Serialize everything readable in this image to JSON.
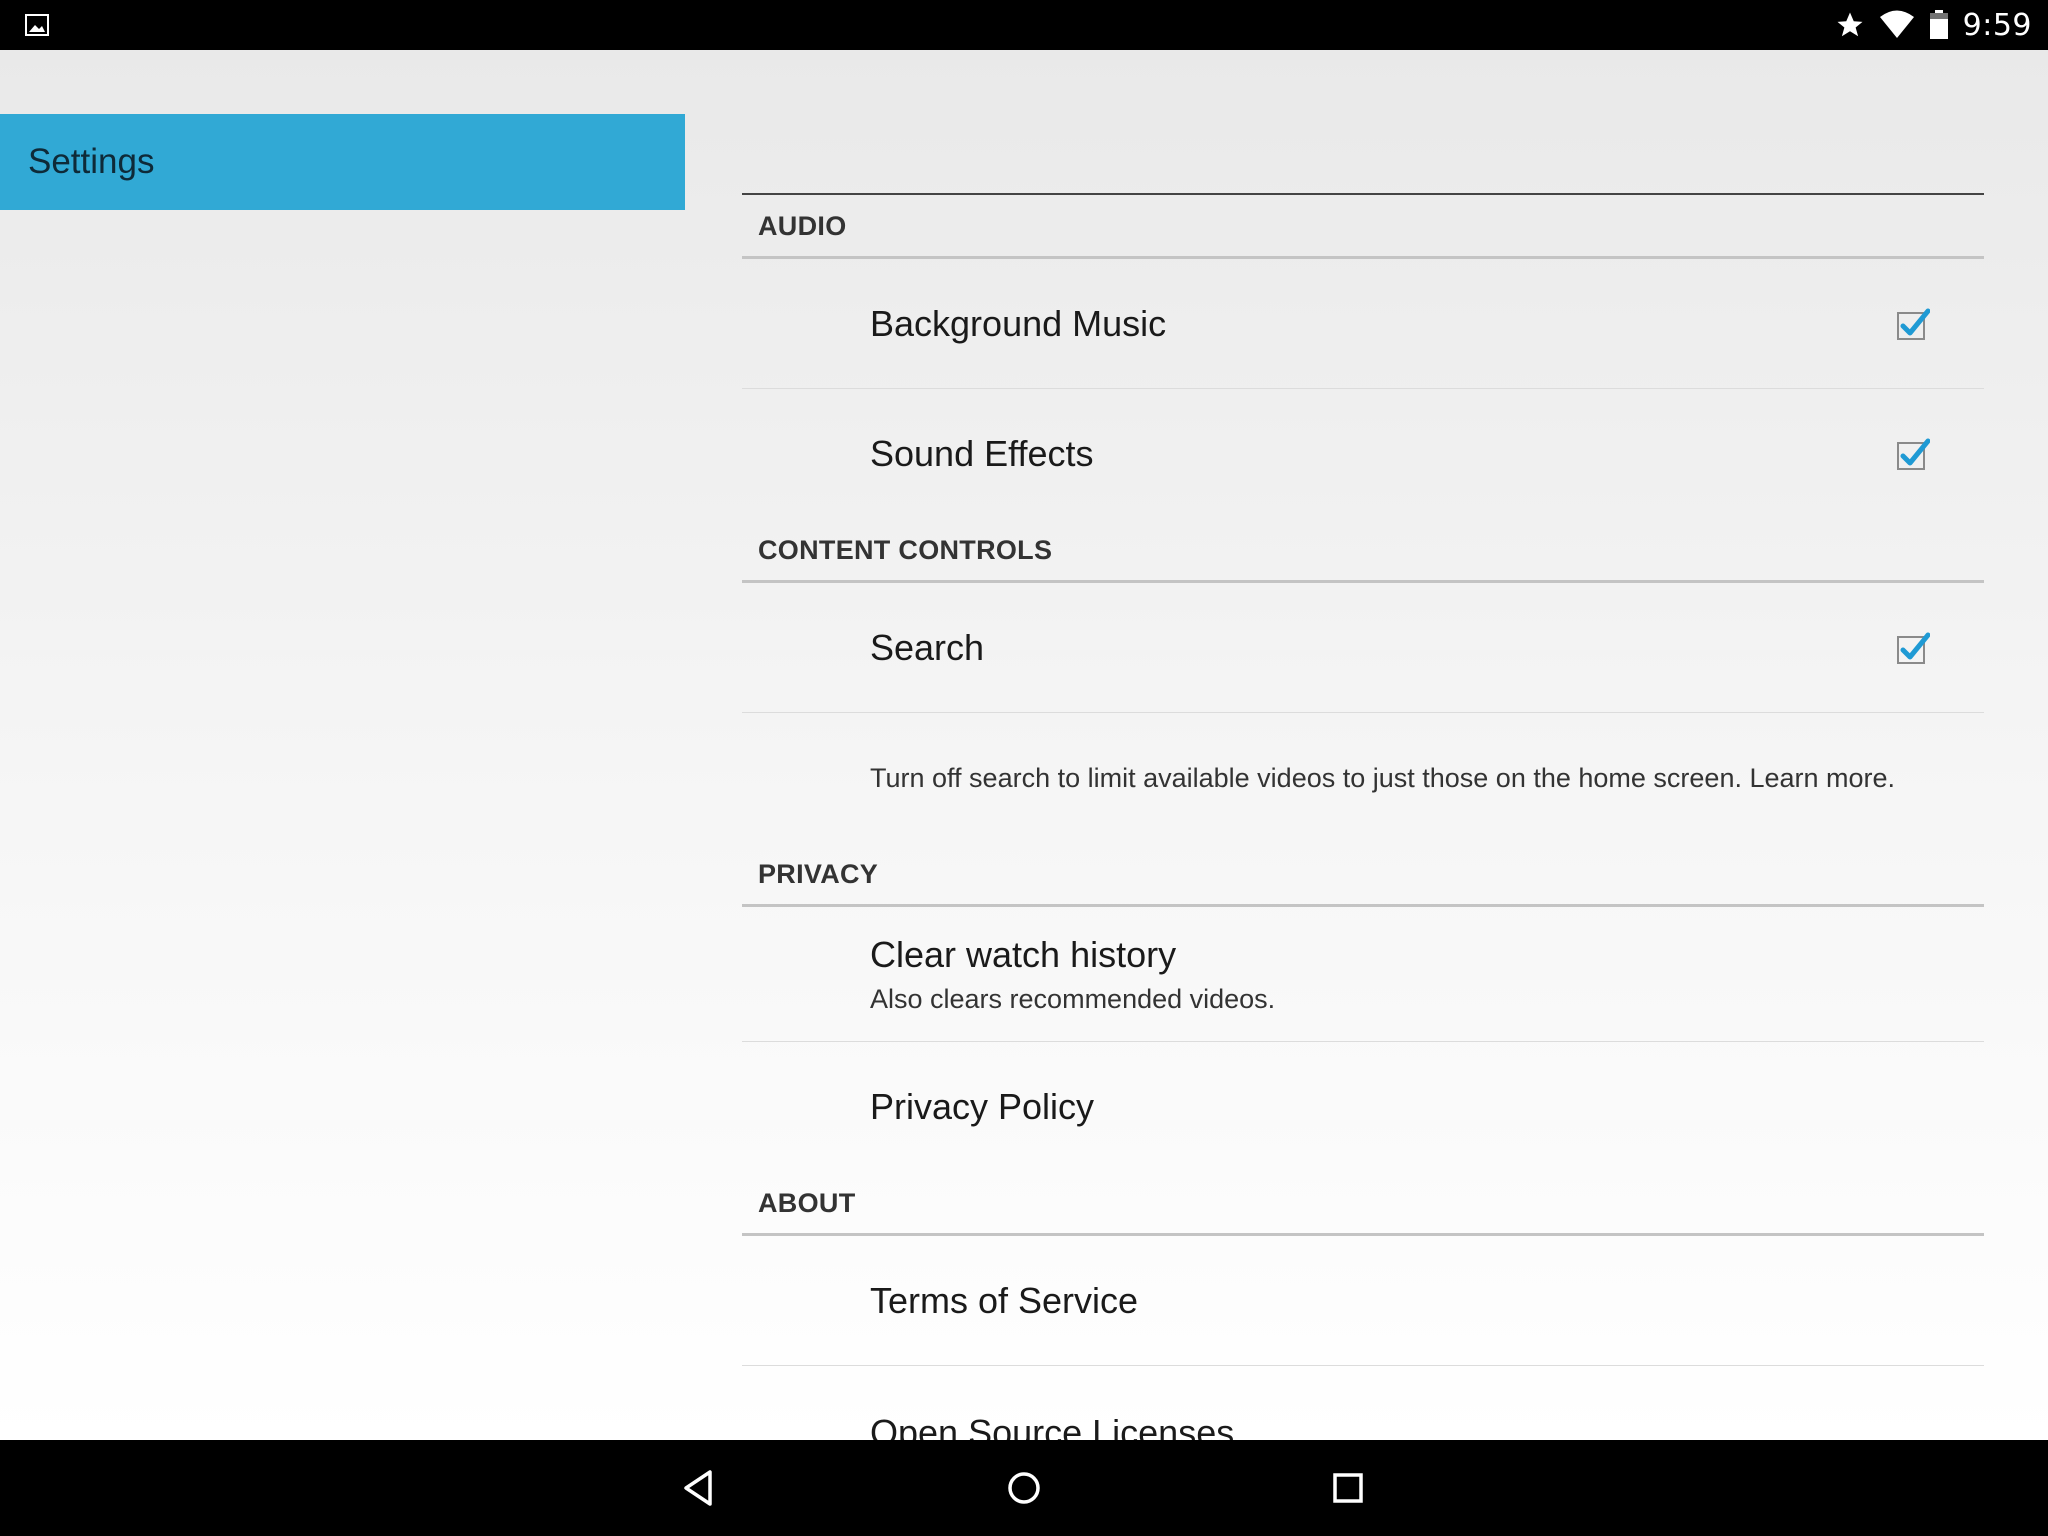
{
  "status_bar": {
    "time": "9:59",
    "icons": [
      "gallery-icon",
      "star-icon",
      "wifi-icon",
      "battery-icon"
    ]
  },
  "sidebar": {
    "header_label": "Settings",
    "accent_color": "#31a9d5"
  },
  "sections": {
    "audio": {
      "header": "AUDIO",
      "background_music": {
        "label": "Background Music",
        "checked": true
      },
      "sound_effects": {
        "label": "Sound Effects",
        "checked": true
      }
    },
    "content_controls": {
      "header": "CONTENT CONTROLS",
      "search": {
        "label": "Search",
        "checked": true
      },
      "note": "Turn off search to limit available videos to just those on the home screen. Learn more."
    },
    "privacy": {
      "header": "PRIVACY",
      "clear_history": {
        "label": "Clear watch history",
        "summary": "Also clears recommended videos."
      },
      "privacy_policy": {
        "label": "Privacy Policy"
      }
    },
    "about": {
      "header": "ABOUT",
      "terms": {
        "label": "Terms of Service"
      },
      "licenses": {
        "label": "Open Source Licenses"
      }
    }
  },
  "nav_bar": {
    "buttons": [
      "back-icon",
      "home-icon",
      "recent-apps-icon"
    ]
  }
}
